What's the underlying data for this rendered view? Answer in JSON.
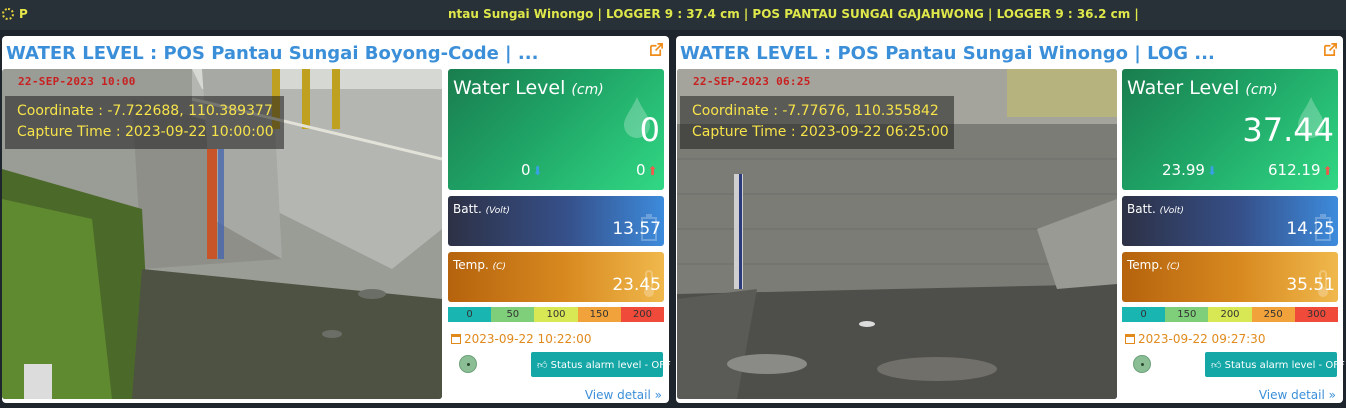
{
  "topbar": {
    "app_letter": "P",
    "ticker": "ntau Sungai Winongo | LOGGER 9 : 37.4 cm | POS PANTAU SUNGAI GAJAHWONG | LOGGER 9 : 36.2 cm |"
  },
  "panels": [
    {
      "title": "WATER LEVEL : POS Pantau Sungai Boyong-Code | ...",
      "camera": {
        "stamp": "22-SEP-2023 10:00",
        "coordinate": "Coordinate : -7.722688, 110.389377",
        "capture_time": "Capture Time : 2023-09-22 10:00:00"
      },
      "water_level": {
        "label": "Water Level",
        "unit": "(cm)",
        "value": "0",
        "min": "0",
        "max": "0"
      },
      "battery": {
        "label": "Batt.",
        "unit": "(Volt)",
        "value": "13.57"
      },
      "temperature": {
        "label": "Temp.",
        "unit": "(C)",
        "value": "23.45"
      },
      "scale": [
        {
          "label": "0",
          "color": "#19b5b0"
        },
        {
          "label": "50",
          "color": "#7fcf7a"
        },
        {
          "label": "100",
          "color": "#d8e854"
        },
        {
          "label": "150",
          "color": "#f2a23a"
        },
        {
          "label": "200",
          "color": "#ef4a3a"
        }
      ],
      "timestamp": "2023-09-22 10:22:00",
      "alarm_button": "Status alarm level - OFF",
      "view_detail": "View detail »"
    },
    {
      "title": "WATER LEVEL : POS Pantau Sungai Winongo | LOG ...",
      "camera": {
        "stamp": "22-SEP-2023 06:25",
        "coordinate": "Coordinate : -7.77676, 110.355842",
        "capture_time": "Capture Time : 2023-09-22 06:25:00"
      },
      "water_level": {
        "label": "Water Level",
        "unit": "(cm)",
        "value": "37.44",
        "min": "23.99",
        "max": "612.19"
      },
      "battery": {
        "label": "Batt.",
        "unit": "(Volt)",
        "value": "14.25"
      },
      "temperature": {
        "label": "Temp.",
        "unit": "(C)",
        "value": "35.51"
      },
      "scale": [
        {
          "label": "0",
          "color": "#19b5b0"
        },
        {
          "label": "150",
          "color": "#7fcf7a"
        },
        {
          "label": "200",
          "color": "#d8e854"
        },
        {
          "label": "250",
          "color": "#f2a23a"
        },
        {
          "label": "300",
          "color": "#ef4a3a"
        }
      ],
      "timestamp": "2023-09-22 09:27:30",
      "alarm_button": "Status alarm level - OFF",
      "view_detail": "View detail »"
    }
  ]
}
